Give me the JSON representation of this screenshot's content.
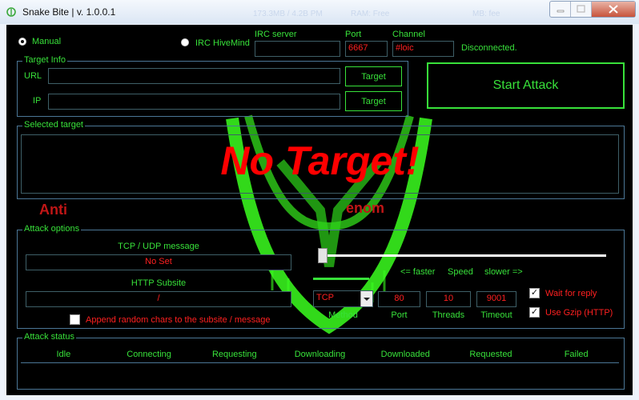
{
  "window": {
    "title": "Snake Bite | v. 1.0.0.1",
    "ghost_texts": [
      "173.3MB / 4.2B PM",
      "RAM: Free",
      "MB: fee"
    ]
  },
  "mode": {
    "manual_label": "Manual",
    "hivemind_label": "IRC HiveMind",
    "selected": "manual"
  },
  "irc": {
    "server_label": "IRC server",
    "server_value": "",
    "port_label": "Port",
    "port_value": "6667",
    "channel_label": "Channel",
    "channel_value": "#loic",
    "status": "Disconnected."
  },
  "target_info": {
    "group_title": "Target Info",
    "url_label": "URL",
    "url_value": "",
    "ip_label": "IP",
    "ip_value": "",
    "url_button": "Target",
    "ip_button": "Target"
  },
  "start_attack": "Start Attack",
  "selected_target": {
    "group_title": "Selected target",
    "value": "No Target!"
  },
  "logo": {
    "left_text": "Anti",
    "right_text": "enom",
    "colors": {
      "green": "#3bff1f",
      "red": "#c11616"
    }
  },
  "attack_options": {
    "group_title": "Attack options",
    "message_label": "TCP / UDP message",
    "message_value": "No Set",
    "subsite_label": "HTTP Subsite",
    "subsite_value": "/",
    "append_label": "Append random chars to the subsite / message",
    "append_checked": false,
    "speed_faster": "<= faster",
    "speed_label": "Speed",
    "speed_slower": "slower =>",
    "speed_fraction": 0.0,
    "method_value": "TCP",
    "method_label": "Method",
    "port_value": "80",
    "port_label": "Port",
    "threads_value": "10",
    "threads_label": "Threads",
    "timeout_value": "9001",
    "timeout_label": "Timeout",
    "wait_label": "Wait for reply",
    "wait_checked": true,
    "gzip_label": "Use Gzip (HTTP)",
    "gzip_checked": true
  },
  "attack_status": {
    "group_title": "Attack status",
    "columns": [
      "Idle",
      "Connecting",
      "Requesting",
      "Downloading",
      "Downloaded",
      "Requested",
      "Failed"
    ]
  },
  "colors": {
    "accent_green": "#38e13a",
    "value_red": "#ff2020",
    "frame_blue": "#4b7696",
    "background": "#000000"
  }
}
